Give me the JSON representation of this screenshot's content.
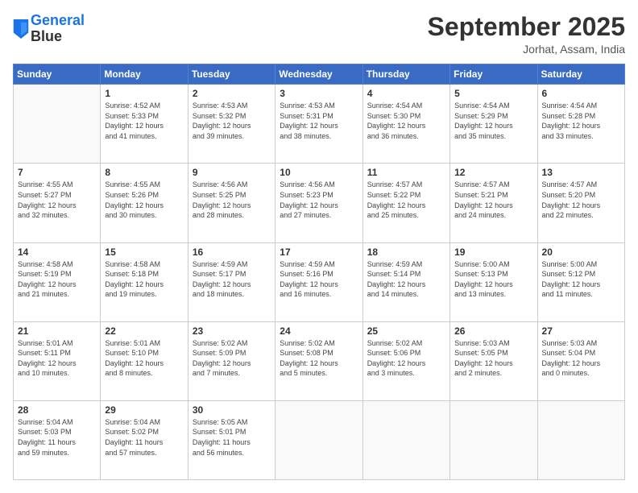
{
  "header": {
    "logo_line1": "General",
    "logo_line2": "Blue",
    "month": "September 2025",
    "location": "Jorhat, Assam, India"
  },
  "days_of_week": [
    "Sunday",
    "Monday",
    "Tuesday",
    "Wednesday",
    "Thursday",
    "Friday",
    "Saturday"
  ],
  "weeks": [
    [
      {
        "day": "",
        "info": ""
      },
      {
        "day": "1",
        "info": "Sunrise: 4:52 AM\nSunset: 5:33 PM\nDaylight: 12 hours\nand 41 minutes."
      },
      {
        "day": "2",
        "info": "Sunrise: 4:53 AM\nSunset: 5:32 PM\nDaylight: 12 hours\nand 39 minutes."
      },
      {
        "day": "3",
        "info": "Sunrise: 4:53 AM\nSunset: 5:31 PM\nDaylight: 12 hours\nand 38 minutes."
      },
      {
        "day": "4",
        "info": "Sunrise: 4:54 AM\nSunset: 5:30 PM\nDaylight: 12 hours\nand 36 minutes."
      },
      {
        "day": "5",
        "info": "Sunrise: 4:54 AM\nSunset: 5:29 PM\nDaylight: 12 hours\nand 35 minutes."
      },
      {
        "day": "6",
        "info": "Sunrise: 4:54 AM\nSunset: 5:28 PM\nDaylight: 12 hours\nand 33 minutes."
      }
    ],
    [
      {
        "day": "7",
        "info": "Sunrise: 4:55 AM\nSunset: 5:27 PM\nDaylight: 12 hours\nand 32 minutes."
      },
      {
        "day": "8",
        "info": "Sunrise: 4:55 AM\nSunset: 5:26 PM\nDaylight: 12 hours\nand 30 minutes."
      },
      {
        "day": "9",
        "info": "Sunrise: 4:56 AM\nSunset: 5:25 PM\nDaylight: 12 hours\nand 28 minutes."
      },
      {
        "day": "10",
        "info": "Sunrise: 4:56 AM\nSunset: 5:23 PM\nDaylight: 12 hours\nand 27 minutes."
      },
      {
        "day": "11",
        "info": "Sunrise: 4:57 AM\nSunset: 5:22 PM\nDaylight: 12 hours\nand 25 minutes."
      },
      {
        "day": "12",
        "info": "Sunrise: 4:57 AM\nSunset: 5:21 PM\nDaylight: 12 hours\nand 24 minutes."
      },
      {
        "day": "13",
        "info": "Sunrise: 4:57 AM\nSunset: 5:20 PM\nDaylight: 12 hours\nand 22 minutes."
      }
    ],
    [
      {
        "day": "14",
        "info": "Sunrise: 4:58 AM\nSunset: 5:19 PM\nDaylight: 12 hours\nand 21 minutes."
      },
      {
        "day": "15",
        "info": "Sunrise: 4:58 AM\nSunset: 5:18 PM\nDaylight: 12 hours\nand 19 minutes."
      },
      {
        "day": "16",
        "info": "Sunrise: 4:59 AM\nSunset: 5:17 PM\nDaylight: 12 hours\nand 18 minutes."
      },
      {
        "day": "17",
        "info": "Sunrise: 4:59 AM\nSunset: 5:16 PM\nDaylight: 12 hours\nand 16 minutes."
      },
      {
        "day": "18",
        "info": "Sunrise: 4:59 AM\nSunset: 5:14 PM\nDaylight: 12 hours\nand 14 minutes."
      },
      {
        "day": "19",
        "info": "Sunrise: 5:00 AM\nSunset: 5:13 PM\nDaylight: 12 hours\nand 13 minutes."
      },
      {
        "day": "20",
        "info": "Sunrise: 5:00 AM\nSunset: 5:12 PM\nDaylight: 12 hours\nand 11 minutes."
      }
    ],
    [
      {
        "day": "21",
        "info": "Sunrise: 5:01 AM\nSunset: 5:11 PM\nDaylight: 12 hours\nand 10 minutes."
      },
      {
        "day": "22",
        "info": "Sunrise: 5:01 AM\nSunset: 5:10 PM\nDaylight: 12 hours\nand 8 minutes."
      },
      {
        "day": "23",
        "info": "Sunrise: 5:02 AM\nSunset: 5:09 PM\nDaylight: 12 hours\nand 7 minutes."
      },
      {
        "day": "24",
        "info": "Sunrise: 5:02 AM\nSunset: 5:08 PM\nDaylight: 12 hours\nand 5 minutes."
      },
      {
        "day": "25",
        "info": "Sunrise: 5:02 AM\nSunset: 5:06 PM\nDaylight: 12 hours\nand 3 minutes."
      },
      {
        "day": "26",
        "info": "Sunrise: 5:03 AM\nSunset: 5:05 PM\nDaylight: 12 hours\nand 2 minutes."
      },
      {
        "day": "27",
        "info": "Sunrise: 5:03 AM\nSunset: 5:04 PM\nDaylight: 12 hours\nand 0 minutes."
      }
    ],
    [
      {
        "day": "28",
        "info": "Sunrise: 5:04 AM\nSunset: 5:03 PM\nDaylight: 11 hours\nand 59 minutes."
      },
      {
        "day": "29",
        "info": "Sunrise: 5:04 AM\nSunset: 5:02 PM\nDaylight: 11 hours\nand 57 minutes."
      },
      {
        "day": "30",
        "info": "Sunrise: 5:05 AM\nSunset: 5:01 PM\nDaylight: 11 hours\nand 56 minutes."
      },
      {
        "day": "",
        "info": ""
      },
      {
        "day": "",
        "info": ""
      },
      {
        "day": "",
        "info": ""
      },
      {
        "day": "",
        "info": ""
      }
    ]
  ]
}
